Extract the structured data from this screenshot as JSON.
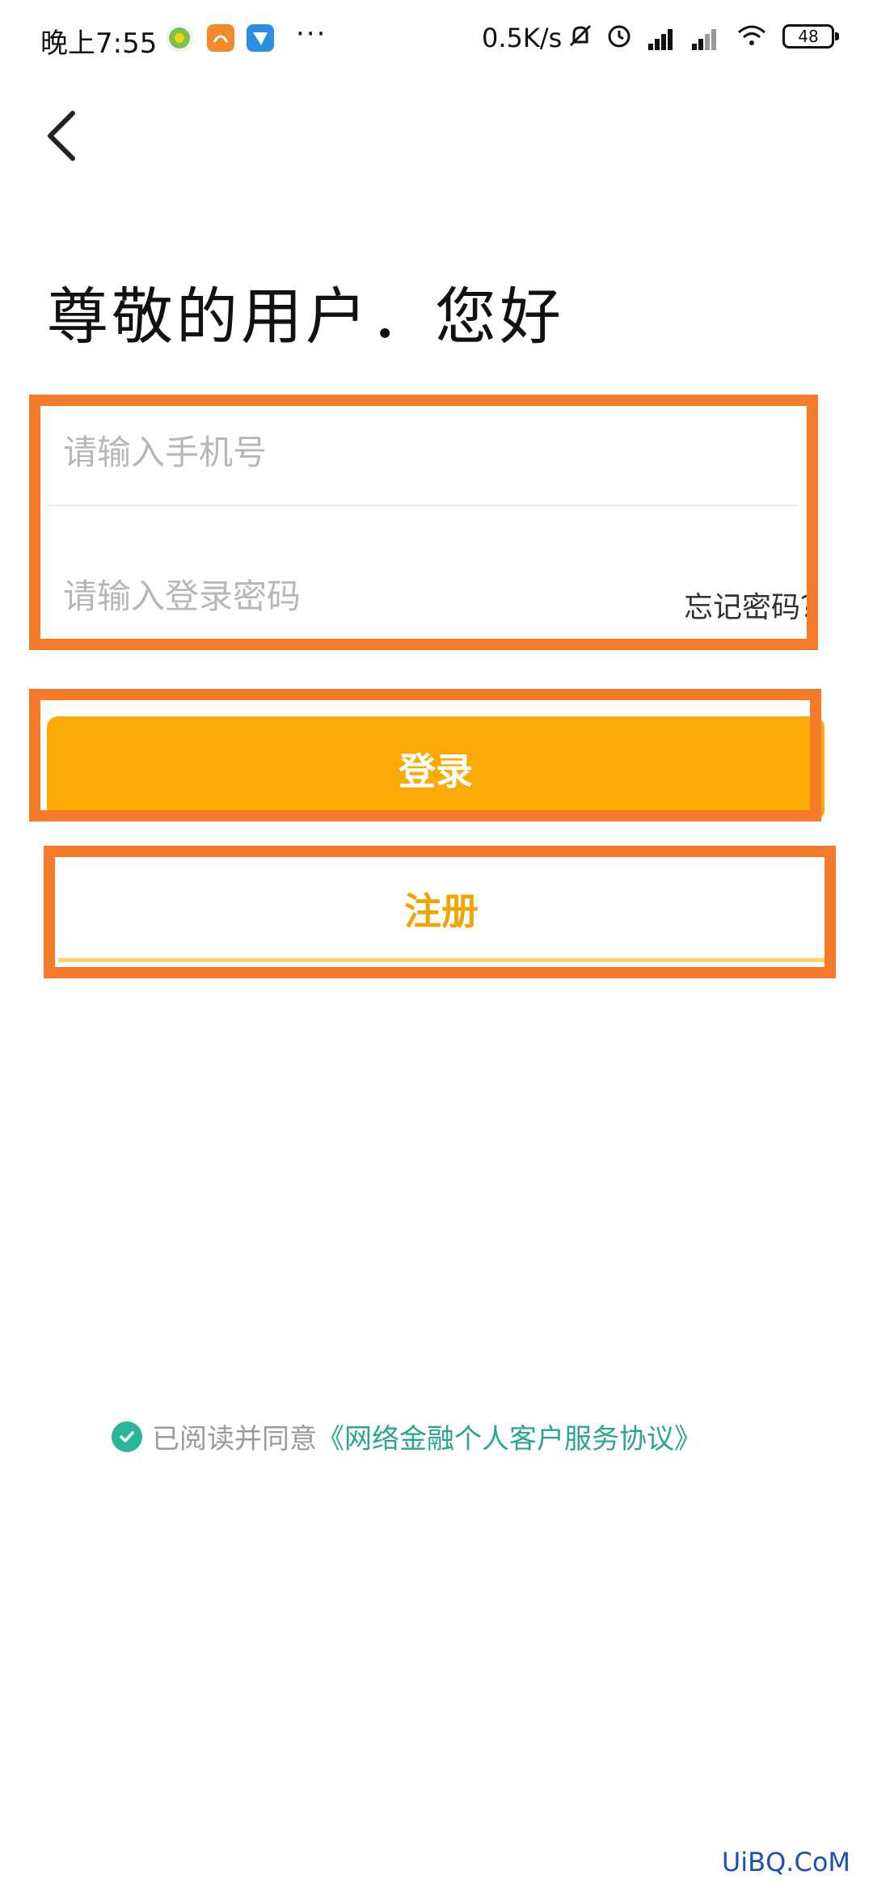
{
  "status_bar": {
    "time": "晚上7:55",
    "app_icons": [
      "green-app-icon",
      "uc-browser-icon",
      "messenger-app-icon"
    ],
    "more": "···",
    "network_speed": "0.5K/s",
    "battery": "48",
    "icons": [
      "silent-bell-icon",
      "alarm-icon",
      "hd-signal-icon",
      "signal-icon",
      "wifi-icon",
      "battery-icon"
    ]
  },
  "header": {
    "back_icon": "chevron-left-icon"
  },
  "greeting": "尊敬的用户．您好",
  "form": {
    "phone_placeholder": "请输入手机号",
    "password_placeholder": "请输入登录密码",
    "forgot_password": "忘记密码？"
  },
  "buttons": {
    "login": "登录",
    "register": "注册"
  },
  "agreement": {
    "prefix": "已阅读并同意",
    "link": "《网络金融个人客户服务协议》",
    "checked": true
  },
  "watermark": "UiBQ.CoM",
  "colors": {
    "accent": "#fbaa05",
    "highlight_frame": "#f47b2a",
    "agreement_green": "#2ba68e",
    "register_text": "#f0a500"
  }
}
